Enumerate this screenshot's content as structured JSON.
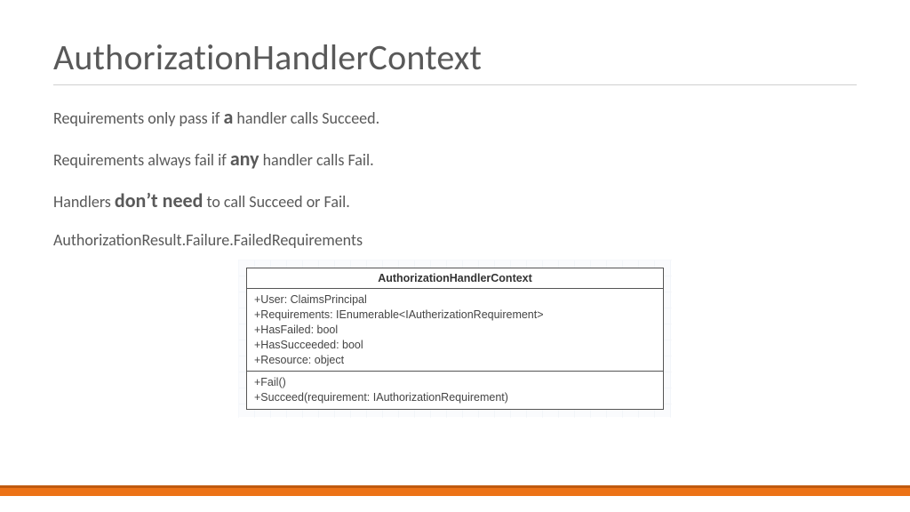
{
  "title": "AuthorizationHandlerContext",
  "lines": {
    "l1a": "Requirements only pass if ",
    "l1b": "a",
    "l1c": " handler calls Succeed.",
    "l2a": "Requirements always fail if ",
    "l2b": "any",
    "l2c": " handler calls Fail.",
    "l3a": "Handlers ",
    "l3b": "don’t need",
    "l3c": " to call Succeed or Fail.",
    "l4": "AuthorizationResult.Failure.FailedRequirements"
  },
  "uml": {
    "className": "AuthorizationHandlerContext",
    "properties": [
      "+User: ClaimsPrincipal",
      "+Requirements: IEnumerable<IAutherizationRequirement>",
      "+HasFailed: bool",
      "+HasSucceeded: bool",
      "+Resource: object"
    ],
    "methods": [
      "+Fail()",
      "+Succeed(requirement: IAuthorizationRequirement)"
    ]
  },
  "colors": {
    "accent": "#ec7216"
  }
}
